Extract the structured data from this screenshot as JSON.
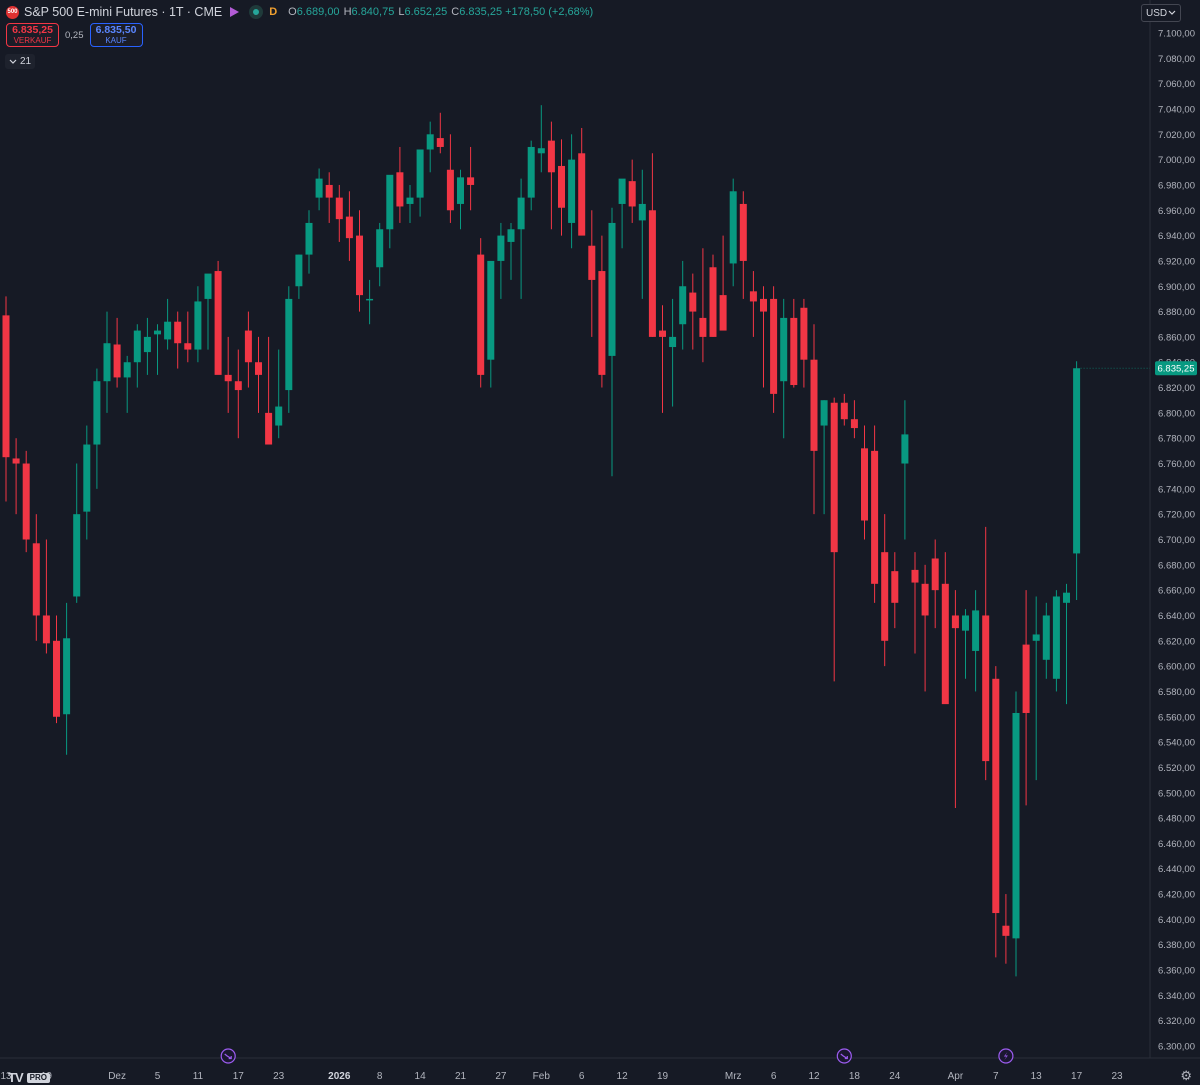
{
  "header": {
    "symbol_logo": "500",
    "title": "S&P 500 E-mini Futures · 1T · CME",
    "interval_badge": "D",
    "ohlc": [
      {
        "label": "O",
        "value": "6.689,00"
      },
      {
        "label": "H",
        "value": "6.840,75"
      },
      {
        "label": "L",
        "value": "6.652,25"
      },
      {
        "label": "C",
        "value": "6.835,25 +178,50 (+2,68%)"
      }
    ]
  },
  "trade": {
    "sell_price": "6.835,25",
    "sell_label": "VERKAUF",
    "spread": "0,25",
    "buy_price": "6.835,50",
    "buy_label": "KAUF"
  },
  "indicator_toggle": {
    "icon": "chevron-down-icon",
    "count": "21"
  },
  "currency": {
    "label": "USD",
    "icon": "chevron-down-icon"
  },
  "logo": {
    "mark": "TV",
    "badge": "PRO"
  },
  "colors": {
    "background": "#161a25",
    "up": "#089981",
    "down": "#f23645",
    "text": "#d1d4dc",
    "axis_text": "#b2b5be"
  },
  "chart_data": {
    "type": "candlestick",
    "y_axis": {
      "range": [
        6300,
        7100
      ],
      "ticks": [
        "7.100,00",
        "7.080,00",
        "7.060,00",
        "7.040,00",
        "7.020,00",
        "7.000,00",
        "6.980,00",
        "6.960,00",
        "6.940,00",
        "6.920,00",
        "6.900,00",
        "6.880,00",
        "6.860,00",
        "6.840,00",
        "6.820,00",
        "6.800,00",
        "6.780,00",
        "6.760,00",
        "6.740,00",
        "6.720,00",
        "6.700,00",
        "6.680,00",
        "6.660,00",
        "6.640,00",
        "6.620,00",
        "6.600,00",
        "6.580,00",
        "6.560,00",
        "6.540,00",
        "6.520,00",
        "6.500,00",
        "6.480,00",
        "6.460,00",
        "6.440,00",
        "6.420,00",
        "6.400,00",
        "6.380,00",
        "6.360,00",
        "6.340,00",
        "6.320,00",
        "6.300,00"
      ]
    },
    "x_axis": {
      "ticks": [
        {
          "label": "13",
          "index": 0,
          "bold": false
        },
        {
          "label": "19",
          "index": 4,
          "bold": false
        },
        {
          "label": "Dez",
          "index": 11,
          "bold": false
        },
        {
          "label": "5",
          "index": 15,
          "bold": false
        },
        {
          "label": "11",
          "index": 19,
          "bold": false
        },
        {
          "label": "17",
          "index": 23,
          "bold": false
        },
        {
          "label": "23",
          "index": 27,
          "bold": false
        },
        {
          "label": "2026",
          "index": 33,
          "bold": true
        },
        {
          "label": "8",
          "index": 37,
          "bold": false
        },
        {
          "label": "14",
          "index": 41,
          "bold": false
        },
        {
          "label": "21",
          "index": 45,
          "bold": false
        },
        {
          "label": "27",
          "index": 49,
          "bold": false
        },
        {
          "label": "Feb",
          "index": 53,
          "bold": false
        },
        {
          "label": "6",
          "index": 57,
          "bold": false
        },
        {
          "label": "12",
          "index": 61,
          "bold": false
        },
        {
          "label": "19",
          "index": 65,
          "bold": false
        },
        {
          "label": "Mrz",
          "index": 72,
          "bold": false
        },
        {
          "label": "6",
          "index": 76,
          "bold": false
        },
        {
          "label": "12",
          "index": 80,
          "bold": false
        },
        {
          "label": "18",
          "index": 84,
          "bold": false
        },
        {
          "label": "24",
          "index": 88,
          "bold": false
        },
        {
          "label": "Apr",
          "index": 94,
          "bold": false
        },
        {
          "label": "7",
          "index": 98,
          "bold": false
        },
        {
          "label": "13",
          "index": 102,
          "bold": false
        },
        {
          "label": "17",
          "index": 106,
          "bold": false
        },
        {
          "label": "23",
          "index": 110,
          "bold": false
        }
      ]
    },
    "event_markers": [
      {
        "icon": "dividend-arrow-icon",
        "index": 22
      },
      {
        "icon": "dividend-arrow-icon",
        "index": 83
      },
      {
        "icon": "lightning-icon",
        "index": 99
      }
    ],
    "last_price_label": "6.835,25",
    "last_price": 6835.25,
    "candles": [
      [
        6877,
        6892,
        6730,
        6765
      ],
      [
        6764,
        6780,
        6720,
        6760
      ],
      [
        6760,
        6770,
        6690,
        6700
      ],
      [
        6697,
        6720,
        6620,
        6640
      ],
      [
        6640,
        6700,
        6610,
        6618
      ],
      [
        6620,
        6640,
        6555,
        6560
      ],
      [
        6562,
        6650,
        6530,
        6622
      ],
      [
        6655,
        6760,
        6650,
        6720
      ],
      [
        6722,
        6790,
        6700,
        6775
      ],
      [
        6775,
        6835,
        6740,
        6825
      ],
      [
        6825,
        6880,
        6800,
        6855
      ],
      [
        6854,
        6875,
        6820,
        6828
      ],
      [
        6828,
        6845,
        6800,
        6840
      ],
      [
        6840,
        6870,
        6820,
        6865
      ],
      [
        6848,
        6875,
        6830,
        6860
      ],
      [
        6862,
        6870,
        6830,
        6865
      ],
      [
        6858,
        6890,
        6850,
        6872
      ],
      [
        6872,
        6880,
        6835,
        6855
      ],
      [
        6855,
        6880,
        6840,
        6850
      ],
      [
        6850,
        6900,
        6840,
        6888
      ],
      [
        6890,
        6902,
        6850,
        6910
      ],
      [
        6912,
        6920,
        6850,
        6830
      ],
      [
        6830,
        6860,
        6800,
        6825
      ],
      [
        6825,
        6850,
        6780,
        6818
      ],
      [
        6865,
        6880,
        6820,
        6840
      ],
      [
        6840,
        6860,
        6800,
        6830
      ],
      [
        6800,
        6860,
        6780,
        6775
      ],
      [
        6790,
        6850,
        6780,
        6805
      ],
      [
        6818,
        6900,
        6800,
        6890
      ],
      [
        6900,
        6925,
        6890,
        6925
      ],
      [
        6925,
        6960,
        6910,
        6950
      ],
      [
        6970,
        6993,
        6960,
        6985
      ],
      [
        6980,
        6990,
        6950,
        6970
      ],
      [
        6970,
        6980,
        6935,
        6953
      ],
      [
        6955,
        6975,
        6920,
        6938
      ],
      [
        6940,
        6960,
        6880,
        6893
      ],
      [
        6890,
        6905,
        6870,
        6890
      ],
      [
        6915,
        6950,
        6900,
        6945
      ],
      [
        6945,
        6975,
        6930,
        6988
      ],
      [
        6990,
        7010,
        6950,
        6963
      ],
      [
        6965,
        6980,
        6950,
        6970
      ],
      [
        6970,
        6990,
        6955,
        7008
      ],
      [
        7008,
        7030,
        6990,
        7020
      ],
      [
        7017,
        7037,
        7005,
        7010
      ],
      [
        6992,
        7020,
        6950,
        6960
      ],
      [
        6965,
        6992,
        6945,
        6986
      ],
      [
        6986,
        7010,
        6960,
        6980
      ],
      [
        6925,
        6938,
        6820,
        6830
      ],
      [
        6842,
        6875,
        6820,
        6920
      ],
      [
        6920,
        6950,
        6890,
        6940
      ],
      [
        6935,
        6950,
        6905,
        6945
      ],
      [
        6945,
        6985,
        6890,
        6970
      ],
      [
        6970,
        7015,
        6960,
        7010
      ],
      [
        7005,
        7043,
        6990,
        7009
      ],
      [
        7015,
        7030,
        6945,
        6990
      ],
      [
        6995,
        7016,
        6940,
        6962
      ],
      [
        6950,
        7020,
        6930,
        7000
      ],
      [
        7005,
        7025,
        6970,
        6940
      ],
      [
        6932,
        6960,
        6860,
        6905
      ],
      [
        6912,
        6940,
        6820,
        6830
      ],
      [
        6845,
        6962,
        6750,
        6950
      ],
      [
        6965,
        6982,
        6930,
        6985
      ],
      [
        6983,
        7000,
        6950,
        6963
      ],
      [
        6952,
        6992,
        6890,
        6965
      ],
      [
        6960,
        7005,
        6860,
        6860
      ],
      [
        6865,
        6885,
        6800,
        6860
      ],
      [
        6852,
        6890,
        6805,
        6860
      ],
      [
        6870,
        6920,
        6850,
        6900
      ],
      [
        6895,
        6910,
        6850,
        6880
      ],
      [
        6875,
        6930,
        6840,
        6860
      ],
      [
        6915,
        6925,
        6860,
        6860
      ],
      [
        6893,
        6940,
        6870,
        6865
      ],
      [
        6918,
        6985,
        6900,
        6975
      ],
      [
        6965,
        6975,
        6890,
        6920
      ],
      [
        6896,
        6912,
        6860,
        6888
      ],
      [
        6890,
        6900,
        6820,
        6880
      ],
      [
        6890,
        6900,
        6800,
        6815
      ],
      [
        6825,
        6890,
        6780,
        6875
      ],
      [
        6875,
        6890,
        6820,
        6822
      ],
      [
        6883,
        6890,
        6820,
        6842
      ],
      [
        6842,
        6870,
        6720,
        6770
      ],
      [
        6790,
        6810,
        6720,
        6810
      ],
      [
        6808,
        6812,
        6588,
        6690
      ],
      [
        6808,
        6815,
        6790,
        6795
      ],
      [
        6795,
        6810,
        6780,
        6788
      ],
      [
        6772,
        6790,
        6700,
        6715
      ],
      [
        6770,
        6790,
        6650,
        6665
      ],
      [
        6690,
        6720,
        6600,
        6620
      ],
      [
        6675,
        6690,
        6630,
        6650
      ],
      [
        6760,
        6810,
        6700,
        6783
      ],
      [
        6676,
        6690,
        6610,
        6666
      ],
      [
        6665,
        6680,
        6580,
        6640
      ],
      [
        6685,
        6700,
        6630,
        6660
      ],
      [
        6665,
        6690,
        6590,
        6570
      ],
      [
        6640,
        6660,
        6488,
        6630
      ],
      [
        6628,
        6645,
        6590,
        6640
      ],
      [
        6612,
        6660,
        6580,
        6644
      ],
      [
        6640,
        6710,
        6510,
        6525
      ],
      [
        6590,
        6600,
        6370,
        6405
      ],
      [
        6395,
        6420,
        6365,
        6387
      ],
      [
        6385,
        6580,
        6355,
        6563
      ],
      [
        6617,
        6660,
        6490,
        6563
      ],
      [
        6620,
        6655,
        6510,
        6625
      ],
      [
        6605,
        6650,
        6590,
        6640
      ],
      [
        6590,
        6660,
        6580,
        6655
      ],
      [
        6650,
        6665,
        6570,
        6658
      ],
      [
        6689,
        6840.75,
        6652.25,
        6835.25
      ]
    ]
  }
}
